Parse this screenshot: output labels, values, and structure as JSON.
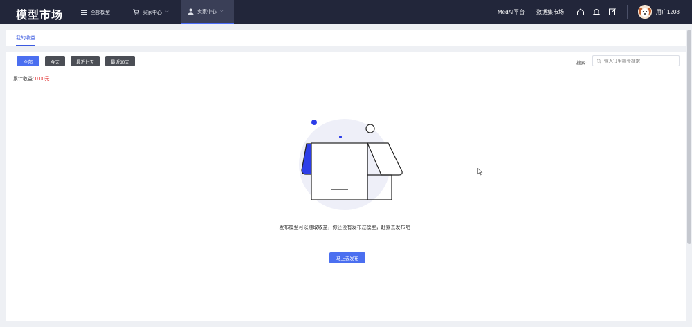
{
  "brand": "模型市场",
  "nav": {
    "items": [
      {
        "label": "全部模型"
      },
      {
        "label": "买家中心"
      },
      {
        "label": "卖家中心"
      }
    ],
    "right_links": [
      "MedAI平台",
      "数据集市场"
    ],
    "username": "用户1208"
  },
  "tabs": [
    {
      "label": "我的收益"
    }
  ],
  "filters": [
    "全部",
    "今天",
    "最近七天",
    "最近30天"
  ],
  "search": {
    "label": "搜索:",
    "placeholder": "输入订单编号搜索"
  },
  "earnings": {
    "label": "累计收益:",
    "value": "0.00元"
  },
  "empty": {
    "message": "发布模型可以赚取收益，你还没有发布过模型，赶紧去发布吧~",
    "button": "马上去发布"
  },
  "colors": {
    "accent": "#4b6ff0",
    "nav_bg": "#22263a",
    "money": "#e02424"
  }
}
